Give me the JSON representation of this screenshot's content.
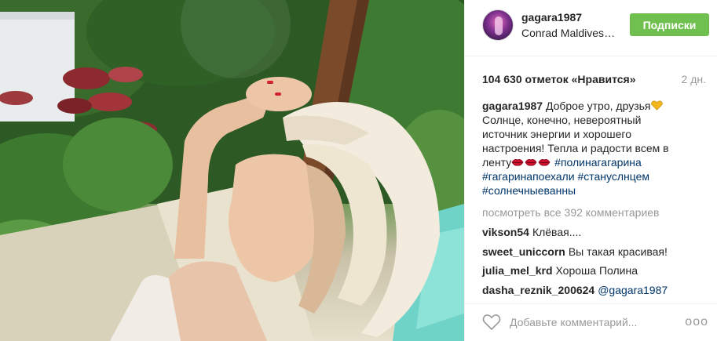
{
  "post": {
    "image_alt": "sun photo",
    "username": "gagara1987",
    "location": "Conrad Maldives Rangali Island",
    "follow_label": "Подписки",
    "likes": "104 630 отметок «Нравится»",
    "age": "2 дн.",
    "caption": {
      "username": "gagara1987",
      "text_1": "Доброе утро, друзья",
      "text_2": "Солнце, конечно, невероятный источник энергии и хорошего настроения! Тепла и радости всем в ленту",
      "tags": [
        "#полинагагарина",
        "#гагаринапоехали",
        "#стануслнцем",
        "#солнечныеванны"
      ]
    },
    "view_all": "посмотреть все 392 комментариев",
    "comments": [
      {
        "user": "vikson54",
        "text": "Клёвая...."
      },
      {
        "user": "sweet_uniccorn",
        "text": "Вы такая красивая!"
      },
      {
        "user": "julia_mel_krd",
        "text": "Хороша Полина"
      },
      {
        "user": "dasha_reznik_200624",
        "text": "@gagara1987"
      }
    ],
    "add_comment_placeholder": "Добавьте комментарий...",
    "more": "ooo"
  },
  "colors": {
    "follow_green": "#70c050",
    "hashtag": "#003569",
    "muted": "#999999"
  }
}
